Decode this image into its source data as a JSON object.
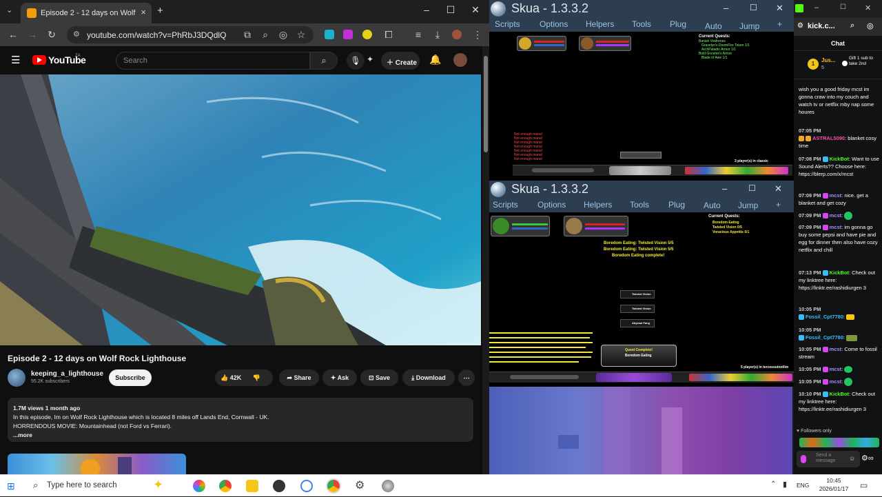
{
  "chrome": {
    "tab_title": "Episode 2 - 12 days on Wolf",
    "url": "youtube.com/watch?v=PhRbJ3DQdlQ"
  },
  "youtube": {
    "logo_text": "YouTube",
    "logo_sup": "ZA",
    "search_placeholder": "Search",
    "create_label": "Create",
    "video_title": "Episode 2 - 12 days on Wolf Rock Lighthouse",
    "channel_name": "keeping_a_lighthouse",
    "subscribers": "55.2K subscribers",
    "subscribe_label": "Subscribe",
    "likes": "42K",
    "share_label": "Share",
    "ask_label": "Ask",
    "save_label": "Save",
    "download_label": "Download",
    "views_date": "1.7M views  1 month ago",
    "desc_line1": "In this episode, Im on Wolf Rock Lighthouse which is located 8 miles off Lands End, Cornwall - UK.",
    "desc_line2": "HORRENDOUS MOVIE: Mountainhead (not Ford vs Ferrari).",
    "more_label": "...more"
  },
  "skua1": {
    "title": "Skua - 1.3.3.2",
    "menu": [
      "Scripts",
      "Options",
      "Helpers",
      "Tools",
      "Plug",
      "Auto",
      "Jump",
      "+"
    ],
    "quests_header": "Current Quests:",
    "quests": [
      "Banish Voidrenes",
      "Gravelyn's DoomFire Token 1/1",
      "ArchPaladin Armor 1/1",
      "Bold Gnoshie's Armor",
      "Blade of Awe 1/1"
    ],
    "chat_lines": [
      "Not enough mana!",
      "Not enough mana!",
      "Not enough mana!",
      "Not enough mana!",
      "Not enough mana!",
      "Not enough mana!",
      "Not enough mana!"
    ],
    "players": "3 player(s) in classic"
  },
  "skua2": {
    "title": "Skua - 1.3.3.2",
    "menu": [
      "Scripts",
      "Options",
      "Helpers",
      "Tools",
      "Plug",
      "Auto",
      "Jump",
      "+"
    ],
    "quests_header": "Current Quests:",
    "quests": [
      "Boredom Eating",
      "Twisted Vision 0/5",
      "Voracious Appetite 0/1"
    ],
    "yellow_lines": [
      "Boredom Eating: Twisted Vision 5/5",
      "Boredom Eating: Twisted Vision 5/5",
      "Boredom Eating complete!"
    ],
    "items": [
      "Twisted Vision",
      "Twisted Vision",
      "Abyssal Fang"
    ],
    "complete_title": "Quest Complete!",
    "complete_name": "Boredom Eating",
    "players": "5 player(s) in tercessuinotlim"
  },
  "kick": {
    "tab_title": "kick.c...",
    "chat_header": "Chat",
    "pinned_user": "Jus...",
    "pinned_count": "5",
    "gift_text": "Gift 1 sub to take 2nd",
    "followers_only": "Followers only",
    "send_placeholder": "Send a message",
    "messages": [
      {
        "time": "",
        "user": "",
        "text": "wish you a good friday mcst im gonna craw into my couch and watch tv or netflix mby nap some houres",
        "color": "#ffffff"
      },
      {
        "time": "07:05 PM",
        "user": "ASTRAL5090",
        "text": "blanket cosy time",
        "color": "#ff4da6"
      },
      {
        "time": "07:08 PM",
        "user": "KickBot",
        "text": "Want to use Sound Alerts?? Choose here: https://blerp.com/x/mcst",
        "color": "#53fc18"
      },
      {
        "time": "07:09 PM",
        "user": "mcst",
        "text": "nice. get a blanket and get cozy",
        "color": "#a78bfa"
      },
      {
        "time": "07:09 PM",
        "user": "mcst",
        "text": "",
        "color": "#a78bfa"
      },
      {
        "time": "07:09 PM",
        "user": "mcst",
        "text": "im gonna go buy some pepsi and have pie and egg for dinner then also have cozy netflix and chill",
        "color": "#a78bfa"
      },
      {
        "time": "07:13 PM",
        "user": "KickBot",
        "text": "Check out my linktree here: https://linktr.ee/rashidiurgen 3",
        "color": "#53fc18"
      },
      {
        "time": "10:05 PM",
        "user": "Fossil_Cpt7780",
        "text": "",
        "color": "#38bdf8"
      },
      {
        "time": "10:05 PM",
        "user": "Fossil_Cpt7780",
        "text": "",
        "color": "#38bdf8"
      },
      {
        "time": "10:05 PM",
        "user": "mcst",
        "text": "Come to fossil stream",
        "color": "#a78bfa"
      },
      {
        "time": "10:05 PM",
        "user": "mcst",
        "text": "",
        "color": "#a78bfa"
      },
      {
        "time": "10:05 PM",
        "user": "mcst",
        "text": "",
        "color": "#a78bfa"
      },
      {
        "time": "10:10 PM",
        "user": "KickBot",
        "text": "Check out my linktree here: https://linktr.ee/rashidiurgen 3",
        "color": "#53fc18"
      }
    ]
  },
  "taskbar": {
    "search_placeholder": "Type here to search",
    "lang": "ENG",
    "time": "10:45",
    "date": "2026/01/17"
  }
}
